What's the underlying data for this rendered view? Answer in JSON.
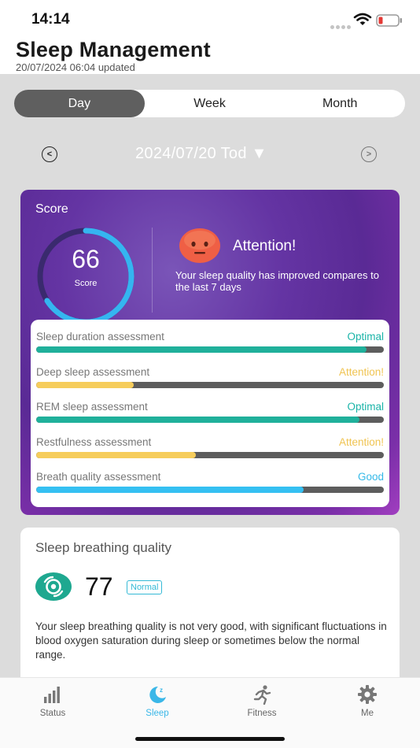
{
  "status_bar": {
    "time": "14:14",
    "wifi_icon": "wifi-icon",
    "battery_icon": "battery-low-icon",
    "battery_color": "#e53935"
  },
  "header": {
    "title": "Sleep Management",
    "updated": "20/07/2024 06:04 updated"
  },
  "tabs": [
    {
      "label": "Day",
      "active": true
    },
    {
      "label": "Week",
      "active": false
    },
    {
      "label": "Month",
      "active": false
    }
  ],
  "date_nav": {
    "prev": "<",
    "date": "2024/07/20 Tod ▼",
    "next": ">"
  },
  "score_card": {
    "title": "Score",
    "score": "66",
    "score_label": "Score",
    "score_fraction": 0.66,
    "ring_color": "#35b5f0",
    "status_title": "Attention!",
    "status_icon": "neutral-face-icon",
    "status_desc": "Your sleep quality has improved compares to the last 7 days",
    "assessments": [
      {
        "label": "Sleep duration assessment",
        "status": "Optimal",
        "status_color": "#1ab4a8",
        "level": 0.95,
        "bar_color": "#20b09b"
      },
      {
        "label": "Deep sleep assessment",
        "status": "Attention!",
        "status_color": "#f0c452",
        "level": 0.28,
        "bar_color": "#f6cd5c"
      },
      {
        "label": "REM sleep assessment",
        "status": "Optimal",
        "status_color": "#1ab4a8",
        "level": 0.93,
        "bar_color": "#20b09b"
      },
      {
        "label": "Restfulness assessment",
        "status": "Attention!",
        "status_color": "#f0c452",
        "level": 0.46,
        "bar_color": "#f6cd5c"
      },
      {
        "label": "Breath quality assessment",
        "status": "Good",
        "status_color": "#35b9e8",
        "level": 0.77,
        "bar_color": "#35c0f2"
      }
    ]
  },
  "breath_card": {
    "title": "Sleep breathing quality",
    "icon": "breathing-icon",
    "score": "77",
    "badge": "Normal",
    "description": "Your sleep breathing quality is not very good, with significant fluctuations in blood oxygen saturation during sleep or sometimes below the normal range."
  },
  "tabbar": [
    {
      "label": "Status",
      "icon": "bar-chart-icon",
      "active": false
    },
    {
      "label": "Sleep",
      "icon": "moon-icon",
      "active": true
    },
    {
      "label": "Fitness",
      "icon": "running-icon",
      "active": false
    },
    {
      "label": "Me",
      "icon": "gear-icon",
      "active": false
    }
  ]
}
